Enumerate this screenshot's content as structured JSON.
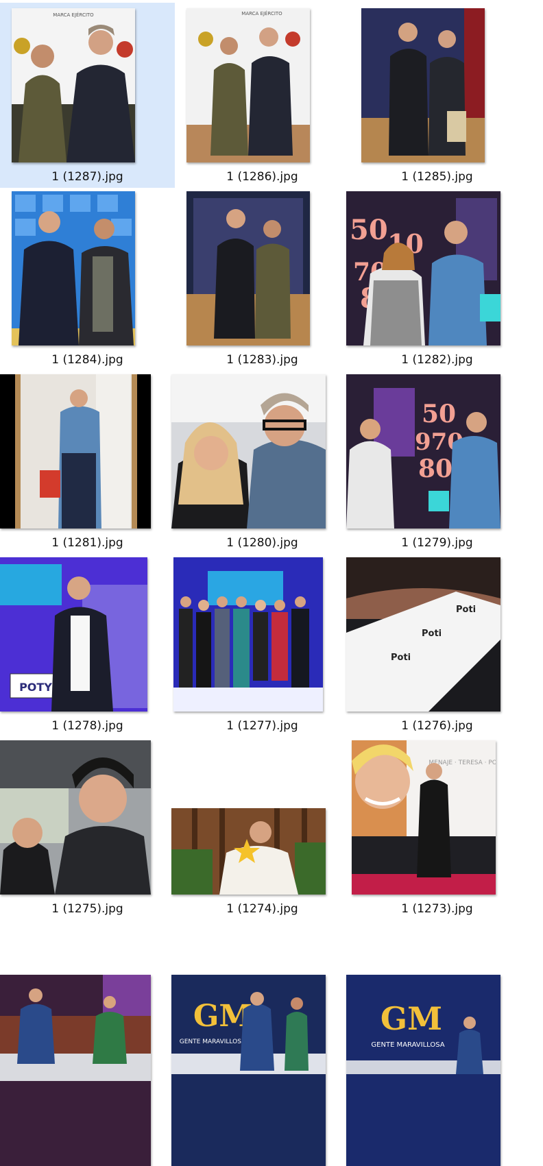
{
  "files": [
    {
      "name": "1 (1287).jpg"
    },
    {
      "name": "1 (1286).jpg"
    },
    {
      "name": "1 (1285).jpg"
    },
    {
      "name": "1 (1284).jpg"
    },
    {
      "name": "1 (1283).jpg"
    },
    {
      "name": "1 (1282).jpg"
    },
    {
      "name": "1 (1281).jpg"
    },
    {
      "name": "1 (1280).jpg"
    },
    {
      "name": "1 (1279).jpg"
    },
    {
      "name": "1 (1278).jpg"
    },
    {
      "name": "1 (1277).jpg"
    },
    {
      "name": "1 (1276).jpg"
    },
    {
      "name": "1 (1275).jpg"
    },
    {
      "name": "1 (1274).jpg"
    },
    {
      "name": "1 (1273).jpg"
    }
  ],
  "thumbnail_text": {
    "marca_ejercito": "MARCA EJÉRCITO",
    "poty": "POTY",
    "gm": "GM",
    "gente_maravillosa": "GENTE MARAVILLOSA",
    "homenaje": "MENAJE · TERESA · POS"
  },
  "colors": {
    "selection": "#d9e8fb",
    "caption": "#111111",
    "background": "#ffffff"
  }
}
